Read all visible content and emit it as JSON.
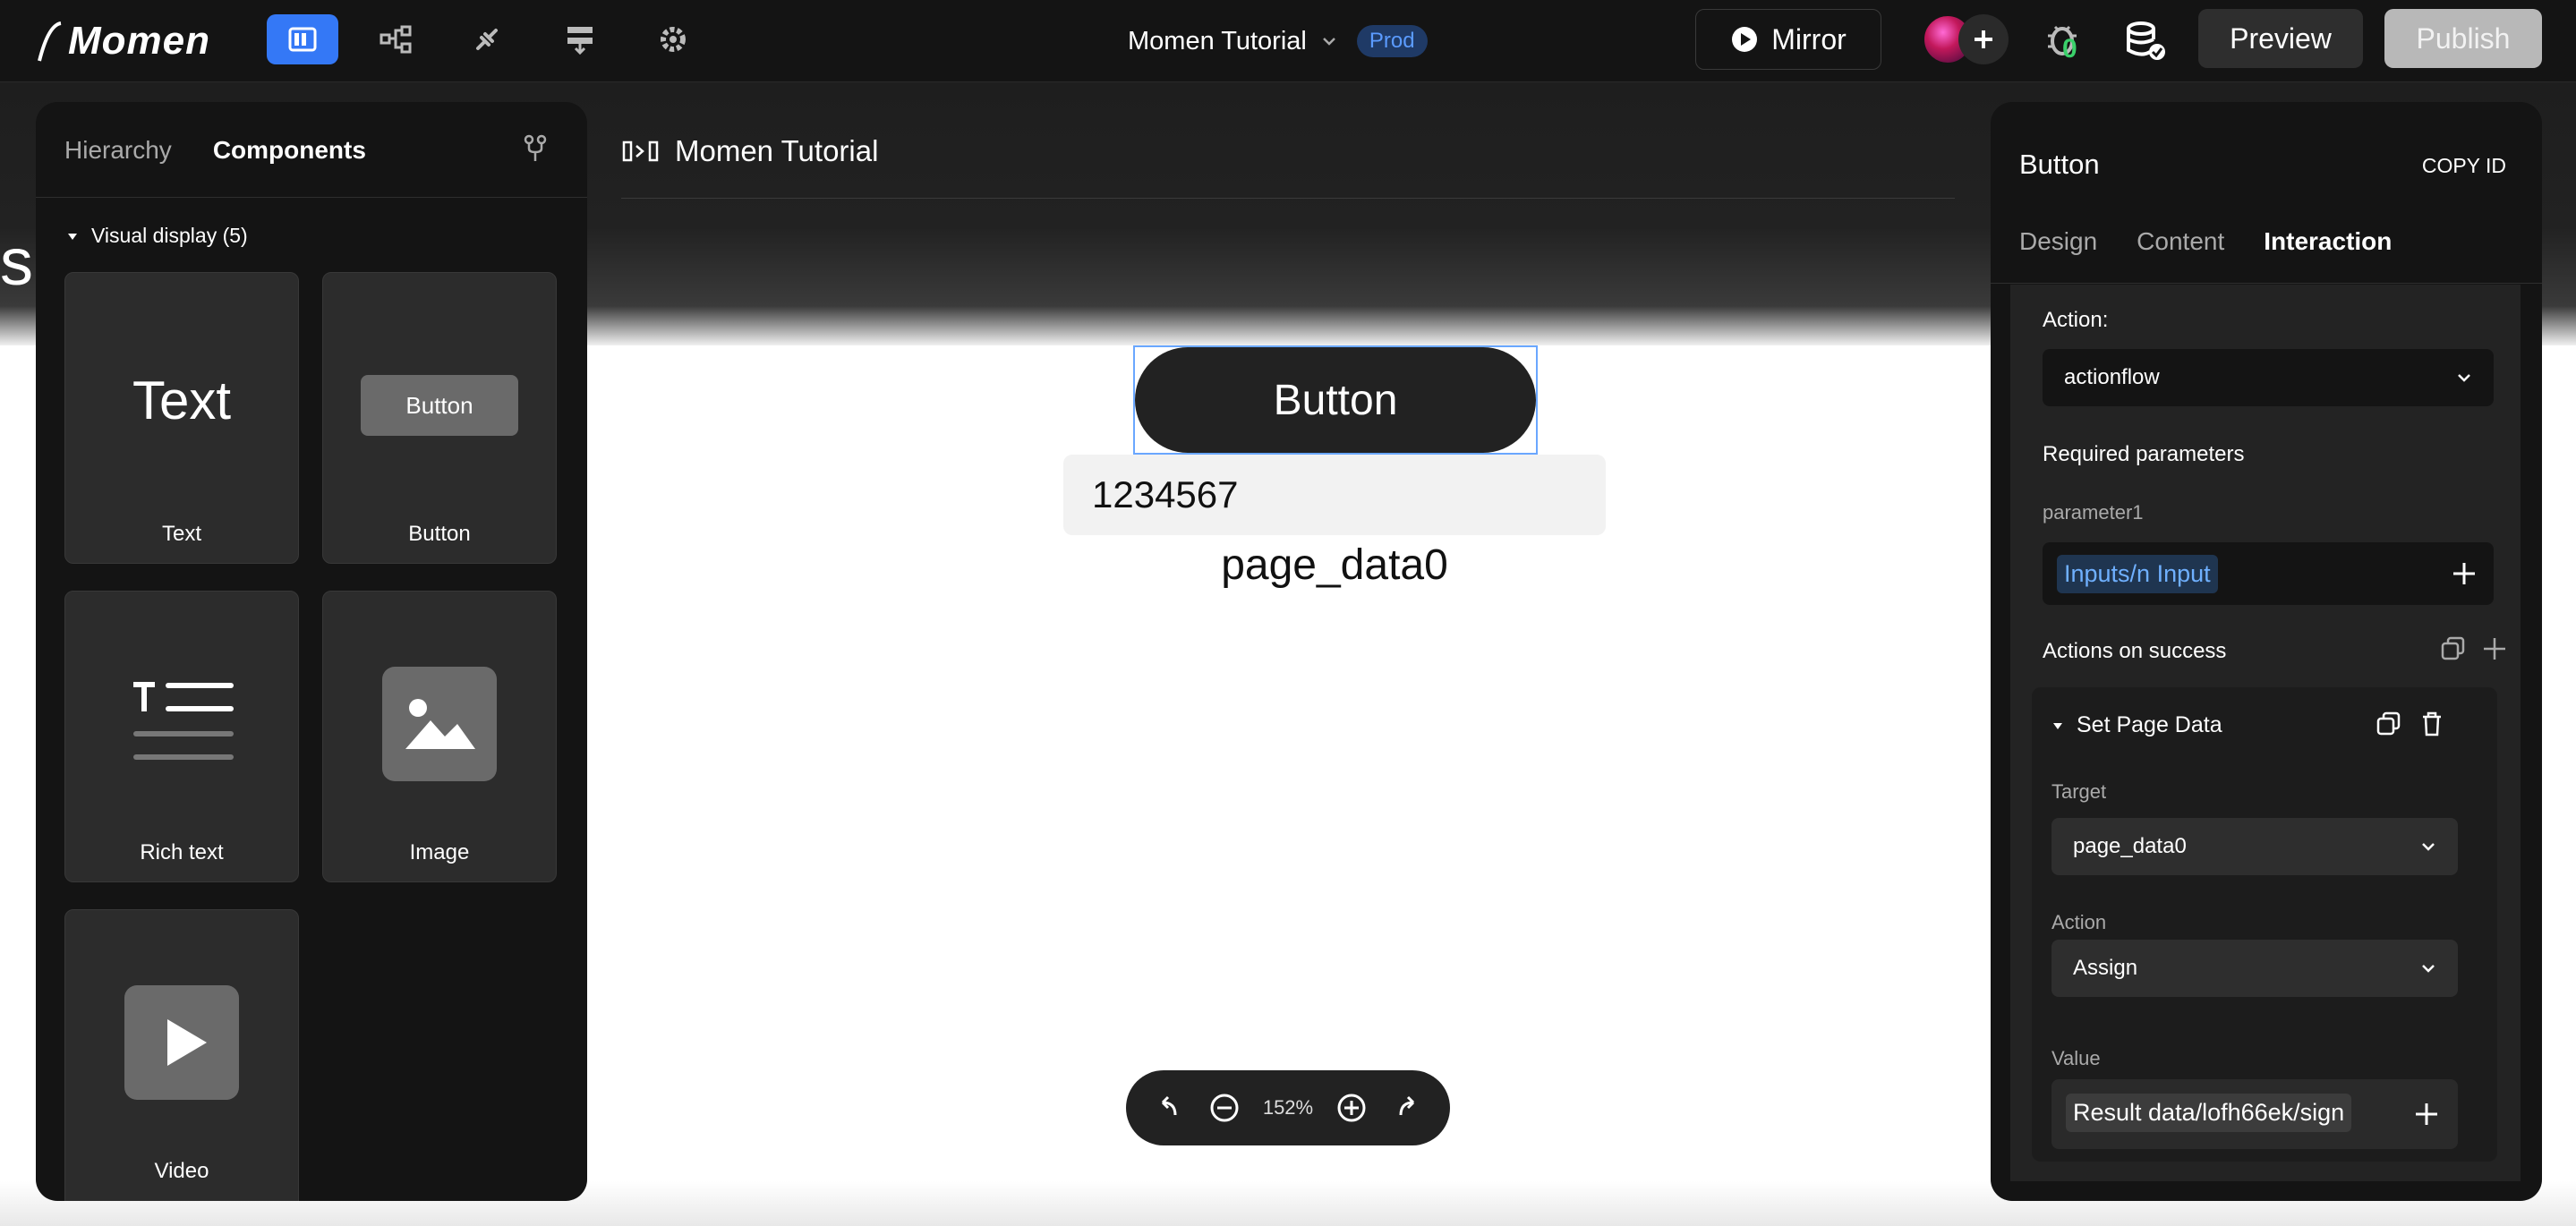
{
  "topbar": {
    "logo_text": "Momen",
    "project_name": "Momen Tutorial",
    "env_badge": "Prod",
    "mirror_label": "Mirror",
    "issues_count": "0",
    "preview_label": "Preview",
    "publish_label": "Publish"
  },
  "left_panel": {
    "tabs": [
      "Hierarchy",
      "Components"
    ],
    "active_tab": "Components",
    "section_title": "Visual display (5)",
    "cards": [
      {
        "label": "Text",
        "preview": "Text",
        "icon": "text-icon"
      },
      {
        "label": "Button",
        "preview": "Button",
        "icon": "button-icon"
      },
      {
        "label": "Rich text",
        "icon": "rich-text-icon"
      },
      {
        "label": "Image",
        "icon": "image-icon"
      },
      {
        "label": "Video",
        "icon": "play-icon"
      }
    ]
  },
  "canvas": {
    "edge_fragment": "sk",
    "page_title": "Momen Tutorial",
    "button_label": "Button",
    "input_value": "1234567",
    "text_value": "page_data0",
    "zoom": "152%"
  },
  "right_panel": {
    "title": "Button",
    "copy_id": "COPY ID",
    "tabs": [
      "Design",
      "Content",
      "Interaction"
    ],
    "active_tab": "Interaction",
    "action_label": "Action:",
    "action_value": "actionflow",
    "required_params_label": "Required parameters",
    "param1_label": "parameter1",
    "param1_value": "Inputs/n Input",
    "actions_on_success_label": "Actions on success",
    "set_page_data": {
      "title": "Set Page Data",
      "target_label": "Target",
      "target_value": "page_data0",
      "action_label": "Action",
      "action_value": "Assign",
      "value_label": "Value",
      "value_value": "Result data/lofh66ek/sign"
    }
  },
  "colors": {
    "accent": "#3478f6",
    "panel_bg": "#141414",
    "link_blue": "#6fb0ff",
    "success_green": "#3ad06a"
  }
}
